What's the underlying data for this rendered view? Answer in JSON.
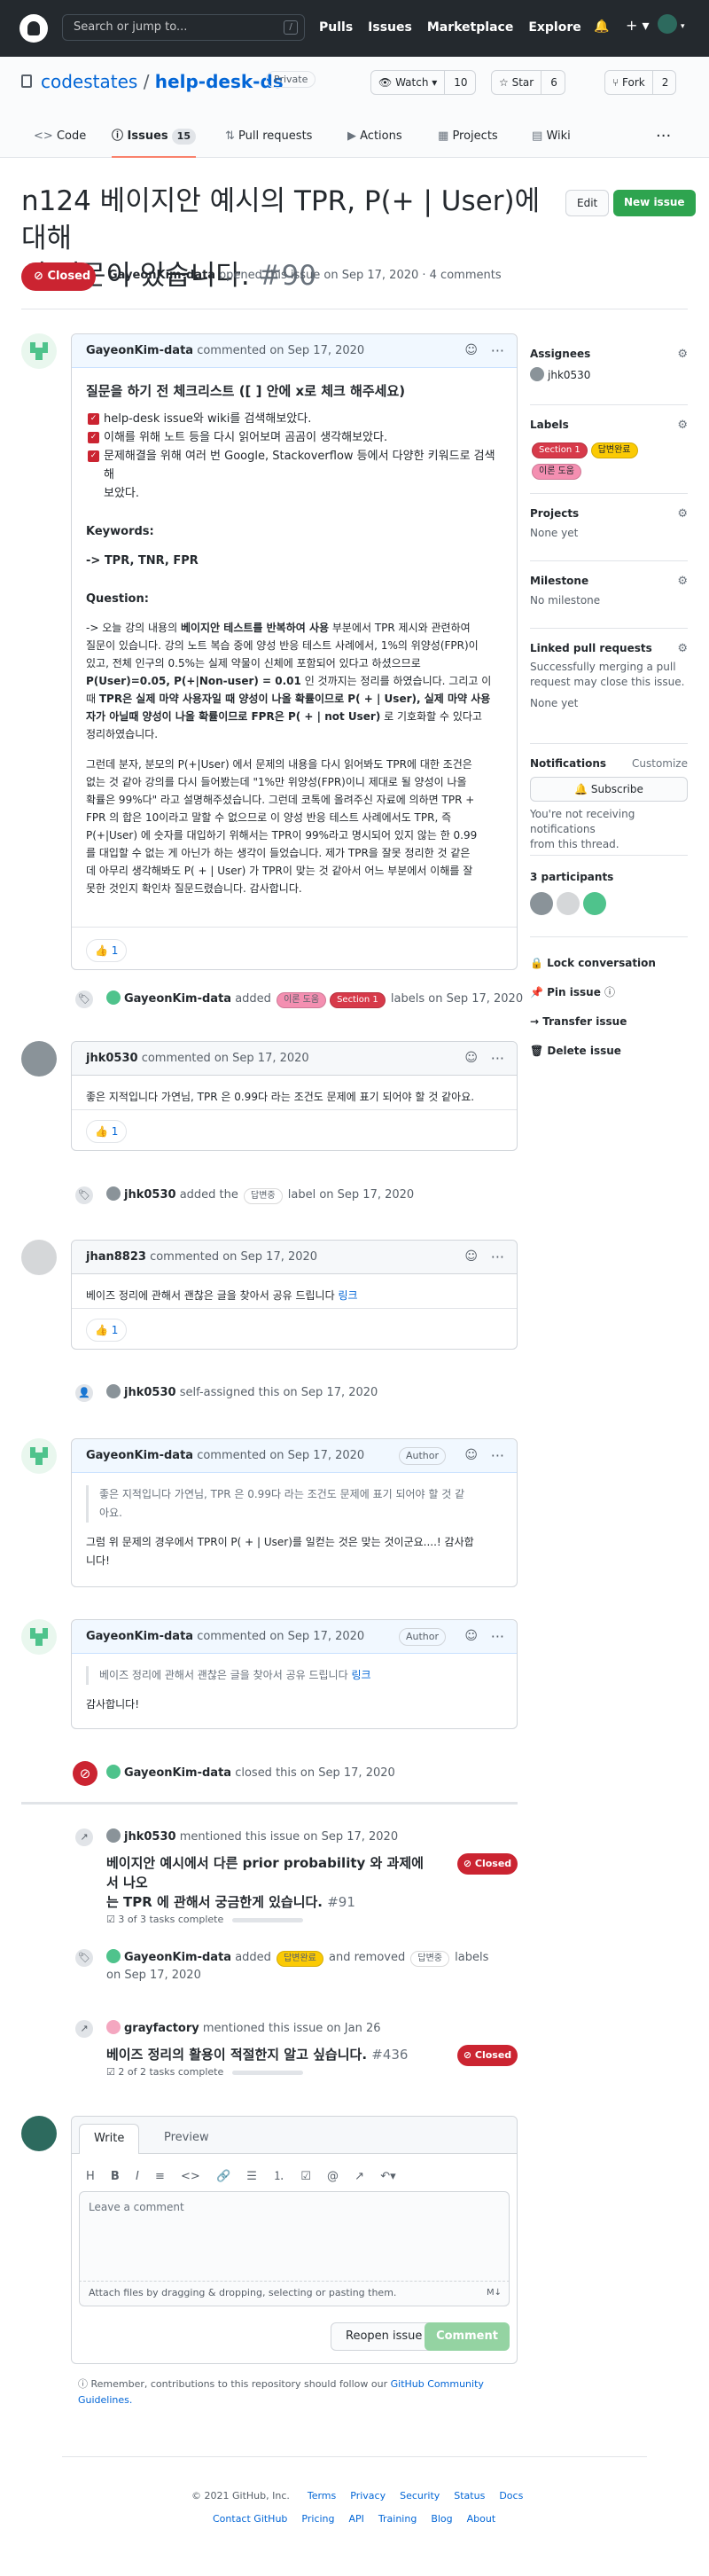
{
  "header": {
    "search_placeholder": "Search or jump to...",
    "slash": "/",
    "nav": [
      "Pulls",
      "Issues",
      "Marketplace",
      "Explore"
    ]
  },
  "repo": {
    "owner": "codestates",
    "sep": "/",
    "name": "help-desk-ds",
    "visibility": "Private",
    "watch_label": "Watch",
    "watch_count": "10",
    "star_label": "Star",
    "star_count": "6",
    "fork_label": "Fork",
    "fork_count": "2"
  },
  "tabs": [
    {
      "label": "Code"
    },
    {
      "label": "Issues",
      "count": "15"
    },
    {
      "label": "Pull requests"
    },
    {
      "label": "Actions"
    },
    {
      "label": "Projects"
    },
    {
      "label": "Wiki"
    }
  ],
  "issue": {
    "title_line1": "n124 베이지안 예시의 TPR, P(+ | User)에 대해",
    "title_line2": "서 질문이 있습니다.",
    "number": "#90",
    "edit_label": "Edit",
    "new_issue_label": "New issue",
    "state": "Closed",
    "author": "GayeonKim-data",
    "meta_rest": "opened this issue on Sep 17, 2020 · 4 comments"
  },
  "comments": [
    {
      "author": "GayeonKim-data",
      "date": "commented on Sep 17, 2020",
      "checklist_title": "질문을 하기 전 체크리스트 ([ ] 안에 x로 체크 해주세요)",
      "checks": [
        "help-desk issue와 wiki를 검색해보았다.",
        "이해를 위해 노트 등을 다시 읽어보며 곰곰이 생각해보았다.",
        "문제해결을 위해 여러 번 Google, Stackoverflow 등에서 다양한 키워드로 검색해",
        "보았다."
      ],
      "keywords_label": "Keywords:",
      "keywords": "-> TPR, TNR, FPR",
      "question_label": "Question:",
      "q1": [
        "-> 오늘 강의 내용의 ",
        "베이지안 테스트를 반복하여 사용",
        " 부분에서 TPR 제시와 관련하여",
        "질문이 있습니다. 강의 노트 복습 중에 양성 반응 테스트 사례에서, 1%의 위양성(FPR)이",
        "있고, 전체 인구의 0.5%는 실제 약물이 신체에 포함되어 있다고 하셨으므로",
        "P(User)=0.05, P(+|Non-user) = 0.01",
        " 인 것까지는 정리를 하였습니다. 그리고 이",
        "때 ",
        "TPR은 실제 마약 사용자일 때 양성이 나올 확률이므로 P( + | User), 실제 마약 사용",
        "자가 아닐때 양성이 나올 확률이므로 FPR은 P( + | not User)",
        " 로 기호화할 수 있다고",
        "정리하였습니다."
      ],
      "q2": [
        "그런데 분자, 분모의 P(+|User) 에서 문제의 내용을 다시 읽어봐도 TPR에 대한 조건은",
        "없는 것 같아 강의를 다시 들어봤는데 \"1%만 위양성(FPR)이니 제대로 될 양성이 나올",
        "확률은 99%다\" 라고 설명해주셨습니다. 그런데 코톡에 올려주신 자료에 의하면 TPR +",
        "FPR 의 합은 10이라고 말할 수 없으므로 이 양성 반응 테스트 사례에서도 TPR, 즉",
        "P(+|User) 에 숫자를 대입하기 위해서는 TPR이 99%라고 명시되어 있지 않는 한 0.99",
        "를 대입할 수 없는 게 아닌가 하는 생각이 들었습니다. 제가 TPR을 잘못 정리한 것 같은",
        "데 아무리 생각해봐도 P( + | User) 가 TPR이 맞는 것 같아서 어느 부분에서 이해를 잘",
        "못한 것인지 확인차 질문드렸습니다. 감사합니다."
      ],
      "reaction": "👍 1"
    },
    {
      "author": "jhk0530",
      "date": "commented on Sep 17, 2020",
      "body": "좋은 지적입니다 가연님, TPR 은 0.99다 라는 조건도 문제에 표기 되어야 할 것 같아요.",
      "reaction": "👍 1"
    },
    {
      "author": "jhan8823",
      "date": "commented on Sep 17, 2020",
      "body": "베이즈 정리에 관해서 괜찮은 글을 찾아서 공유 드립니다 ",
      "link": "링크",
      "reaction": "👍 1"
    },
    {
      "author": "GayeonKim-data",
      "date": "commented on Sep 17, 2020",
      "badge": "Author",
      "quote": "좋은 지적입니다 가연님, TPR 은 0.99다 라는 조건도 문제에 표기 되어야 할 것 같",
      "quote2": "아요.",
      "body": "그럼 위 문제의 경우에서 TPR이 P( + | User)를 일컫는 것은 맞는 것이군요....! 감사합",
      "body2": "니다!"
    },
    {
      "author": "GayeonKim-data",
      "date": "commented on Sep 17, 2020",
      "badge": "Author",
      "quote": "베이즈 정리에 관해서 괜찮은 글을 찾아서 공유 드립니다 ",
      "quote_link": "링크",
      "body": "감사합니다!"
    }
  ],
  "events": {
    "labels1": {
      "actor": "GayeonKim-data",
      "verb": "added",
      "l1": "이론 도움",
      "l2": "Section 1",
      "rest": "labels on Sep 17, 2020"
    },
    "label2": {
      "actor": "jhk0530",
      "verb": "added the",
      "l1": "답변중",
      "rest": "label on Sep 17, 2020"
    },
    "assign": {
      "actor": "jhk0530",
      "rest": "self-assigned this on Sep 17, 2020"
    },
    "closed": {
      "actor": "GayeonKim-data",
      "rest": "closed this on Sep 17, 2020"
    },
    "mention1": {
      "actor": "jhk0530",
      "rest": "mentioned this issue on Sep 17, 2020",
      "title1": "베이지안 예시에서 다른 prior probability 와 과제에서 나오",
      "title2": "는 TPR 에 관해서 궁금한게 있습니다.",
      "num": "#91",
      "tasks": "3 of 3 tasks complete",
      "state": "Closed"
    },
    "labels3": {
      "actor": "GayeonKim-data",
      "verb": "added",
      "l1": "답변완료",
      "mid": "and removed",
      "l2": "답변중",
      "rest": "labels",
      "date": "on Sep 17, 2020"
    },
    "mention2": {
      "actor": "grayfactory",
      "rest": "mentioned this issue on Jan 26",
      "title": "베이즈 정리의 활용이 적절한지 알고 싶습니다.",
      "num": "#436",
      "tasks": "2 of 2 tasks complete",
      "state": "Closed"
    }
  },
  "sidebar": {
    "assignees_h": "Assignees",
    "assignee": "jhk0530",
    "labels_h": "Labels",
    "labels": [
      "Section 1",
      "답변완료",
      "이론 도움"
    ],
    "projects_h": "Projects",
    "projects_v": "None yet",
    "milestone_h": "Milestone",
    "milestone_v": "No milestone",
    "linked_h": "Linked pull requests",
    "linked_desc1": "Successfully merging a pull",
    "linked_desc2": "request may close this issue.",
    "linked_v": "None yet",
    "notif_h": "Notifications",
    "customize": "Customize",
    "subscribe": "Subscribe",
    "notif_desc1": "You're not receiving notifications",
    "notif_desc2": "from this thread.",
    "participants": "3 participants",
    "lock": "Lock conversation",
    "pin": "Pin issue",
    "transfer": "Transfer issue",
    "delete": "Delete issue"
  },
  "composer": {
    "write": "Write",
    "preview": "Preview",
    "placeholder": "Leave a comment",
    "attach": "Attach files by dragging & dropping, selecting or pasting them.",
    "reopen": "Reopen issue",
    "comment": "Comment",
    "remember": "Remember, contributions to this repository should follow our ",
    "guidelines1": "GitHub Community",
    "guidelines2": "Guidelines."
  },
  "footer": {
    "copyright": "© 2021 GitHub, Inc.",
    "links1": [
      "Terms",
      "Privacy",
      "Security",
      "Status",
      "Docs"
    ],
    "links2": [
      "Contact GitHub",
      "Pricing",
      "API",
      "Training",
      "Blog",
      "About"
    ]
  },
  "colors": {
    "closed": "#cb2431",
    "green": "#2ea44f",
    "link": "#0366d6",
    "lbl_section": "#d73a4a",
    "lbl_done": "#fbca04",
    "lbl_theory": "#f48fb1"
  }
}
